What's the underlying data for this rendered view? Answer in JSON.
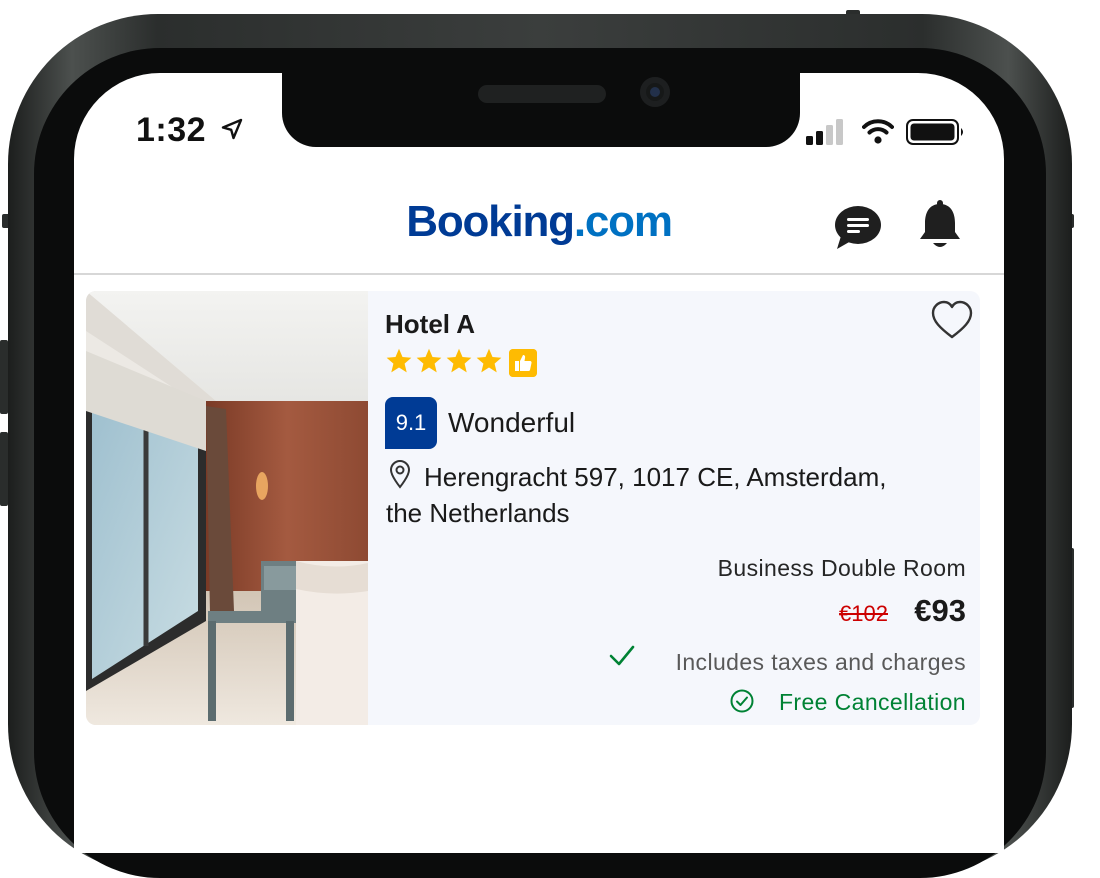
{
  "status_bar": {
    "time": "1:32"
  },
  "header": {
    "logo_part1": "Booking",
    "logo_part2": ".com",
    "chat_icon": "chat-bubble-icon",
    "bell_icon": "bell-icon"
  },
  "hotel": {
    "name": "Hotel A",
    "stars": 4,
    "score": "9.1",
    "score_label": "Wonderful",
    "address": "Herengracht 597, 1017 CE, Amsterdam, the Netherlands",
    "room_type": "Business Double Room",
    "old_price": "€102",
    "price": "€93",
    "taxes_note": "Includes taxes and charges",
    "cancellation": "Free Cancellation"
  },
  "colors": {
    "brand_dark": "#003b95",
    "brand_light": "#0071c2",
    "star": "#febb02",
    "price_old": "#cc0000",
    "success": "#008234"
  }
}
